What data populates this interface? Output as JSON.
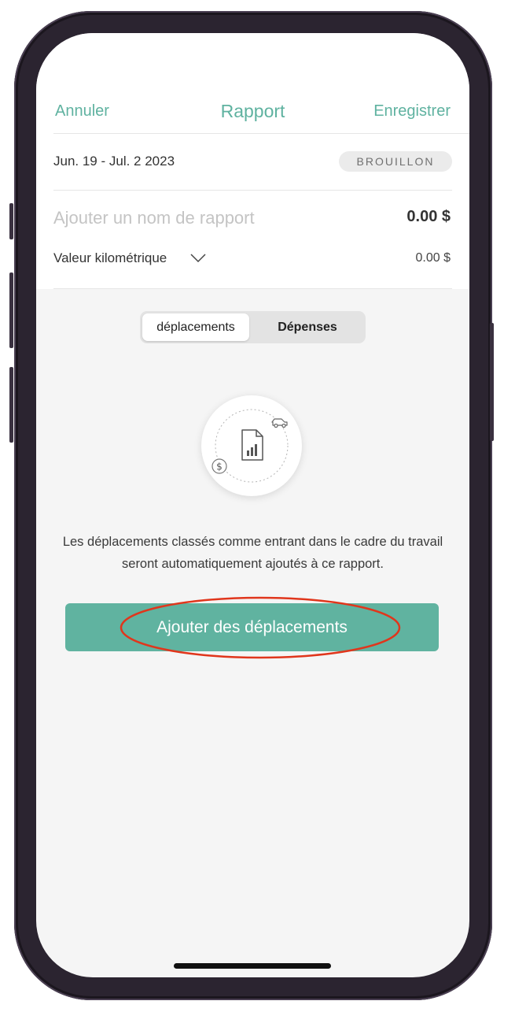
{
  "nav": {
    "cancel_label": "Annuler",
    "title": "Rapport",
    "save_label": "Enregistrer"
  },
  "report": {
    "date_range": "Jun. 19 - Jul. 2 2023",
    "status": "BROUILLON",
    "name_placeholder": "Ajouter un nom de rapport",
    "total": "0.00 $",
    "mileage_label": "Valeur kilométrique",
    "mileage_value": "0.00 $"
  },
  "tabs": [
    {
      "label": "déplacements",
      "selected": true
    },
    {
      "label": "Dépenses",
      "selected": false
    }
  ],
  "empty_state": {
    "icons": [
      "car-icon",
      "document-chart-icon",
      "dollar-icon"
    ],
    "message": "Les déplacements classés comme entrant dans le cadre du travail seront automatiquement ajoutés à ce rapport.",
    "button_label": "Ajouter des déplacements"
  },
  "colors": {
    "accent": "#5fb2a0",
    "button": "#60b3a0",
    "annotation": "#e0361c"
  }
}
